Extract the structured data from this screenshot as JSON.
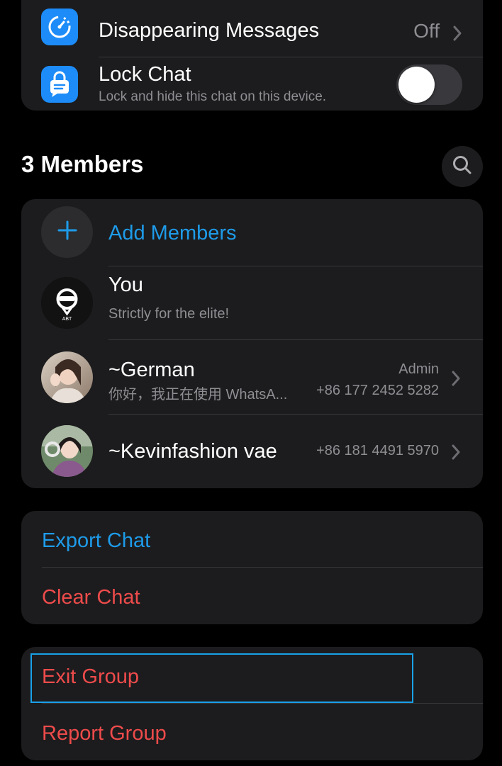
{
  "settings": {
    "disappearing": {
      "label": "Disappearing Messages",
      "value": "Off"
    },
    "lock_chat": {
      "label": "Lock Chat",
      "subtitle": "Lock and hide this chat on this device.",
      "enabled": false
    }
  },
  "members_section": {
    "title": "3 Members",
    "add_label": "Add Members",
    "members": [
      {
        "name": "You",
        "status": "Strictly for the elite!",
        "role": "",
        "phone": ""
      },
      {
        "name": "~German",
        "status": "你好，我正在使用 WhatsA...",
        "role": "Admin",
        "phone": "+86 177 2452 5282"
      },
      {
        "name": "~Kevinfashion vae",
        "status": "",
        "role": "",
        "phone": "+86 181 4491 5970"
      }
    ],
    "avatar_logo_text": "ABT"
  },
  "actions": {
    "export": "Export Chat",
    "clear": "Clear Chat",
    "exit": "Exit Group",
    "report": "Report Group"
  },
  "icons": {
    "disappearing": "timer-icon",
    "lock": "lock-chat-icon",
    "search": "search-icon",
    "add": "plus-icon",
    "chevron": "chevron-right-icon"
  },
  "colors": {
    "accent_blue": "#1e9be9",
    "destructive_red": "#ee4b4b",
    "icon_blue": "#1d8cf8",
    "focus_outline": "#1aa1e8"
  }
}
